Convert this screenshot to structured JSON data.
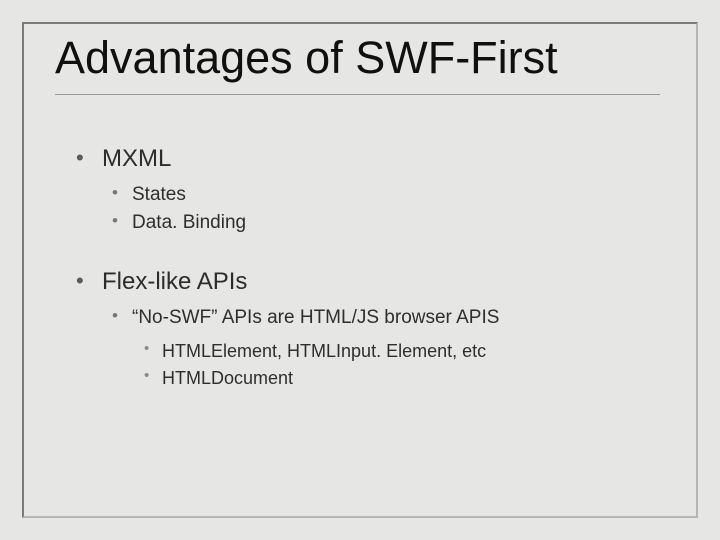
{
  "title": "Advantages of SWF-First",
  "bullets": [
    {
      "label": "MXML",
      "children": [
        {
          "label": "States"
        },
        {
          "label": "Data. Binding"
        }
      ]
    },
    {
      "label": "Flex-like APIs",
      "children": [
        {
          "label": "“No-SWF” APIs are HTML/JS browser APIS",
          "children": [
            {
              "label": "HTMLElement, HTMLInput. Element, etc"
            },
            {
              "label": "HTMLDocument"
            }
          ]
        }
      ]
    }
  ]
}
